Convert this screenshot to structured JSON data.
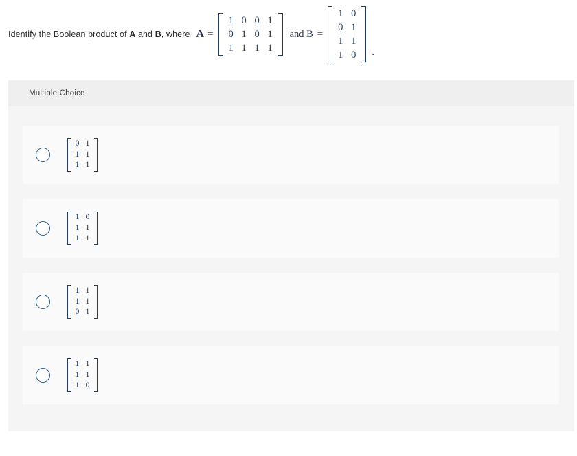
{
  "question": {
    "text_before": "Identify the Boolean product of ",
    "bold_a": "A",
    "text_mid": " and ",
    "bold_b": "B",
    "text_after": ", where",
    "label_a": "A",
    "equals_a": "=",
    "and_b_label": "and B",
    "equals_b": "=",
    "period": ".",
    "matrix_a": [
      [
        "1",
        "0",
        "0",
        "1"
      ],
      [
        "0",
        "1",
        "0",
        "1"
      ],
      [
        "1",
        "1",
        "1",
        "1"
      ]
    ],
    "matrix_b": [
      [
        "1",
        "0"
      ],
      [
        "0",
        "1"
      ],
      [
        "1",
        "1"
      ],
      [
        "1",
        "0"
      ]
    ]
  },
  "answer_panel": {
    "header_label": "Multiple Choice",
    "options": [
      {
        "selected": false,
        "matrix": [
          [
            "0",
            "1"
          ],
          [
            "1",
            "1"
          ],
          [
            "1",
            "1"
          ]
        ]
      },
      {
        "selected": false,
        "matrix": [
          [
            "1",
            "0"
          ],
          [
            "1",
            "1"
          ],
          [
            "1",
            "1"
          ]
        ]
      },
      {
        "selected": false,
        "matrix": [
          [
            "1",
            "1"
          ],
          [
            "1",
            "1"
          ],
          [
            "0",
            "1"
          ]
        ]
      },
      {
        "selected": false,
        "matrix": [
          [
            "1",
            "1"
          ],
          [
            "1",
            "1"
          ],
          [
            "1",
            "0"
          ]
        ]
      }
    ]
  },
  "colors": {
    "page_background": "#ffffff",
    "panel_background": "#f5f5f5",
    "panel_header_background": "#efefef",
    "option_card_background": "#fafafa",
    "math_ink": "#24405e",
    "radio_border": "#2b5c8a",
    "body_text": "#2b2b2b"
  }
}
